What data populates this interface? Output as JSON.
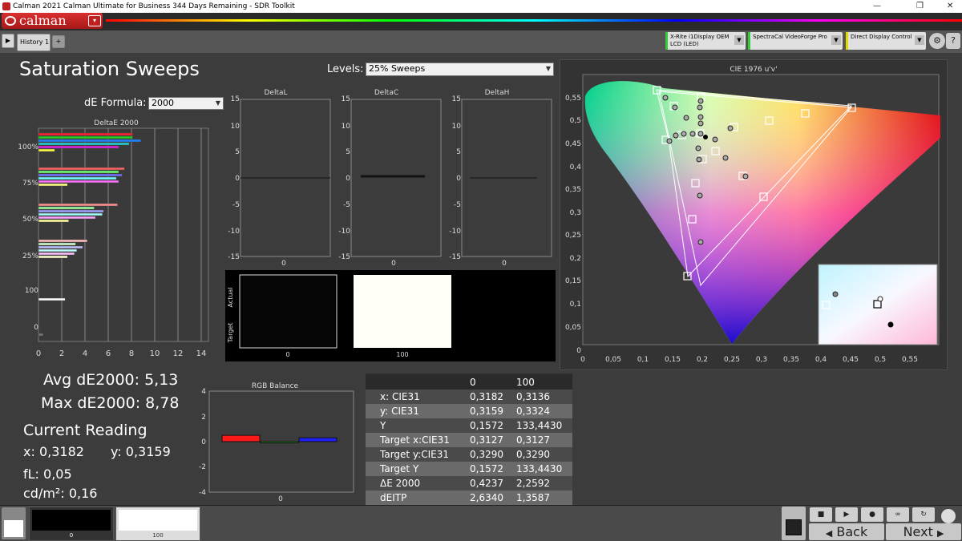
{
  "window": {
    "title": "Calman 2021 Calman Ultimate for Business 344 Days Remaining  - SDR Toolkit",
    "minimize": "—",
    "restore": "❐",
    "close": "✕"
  },
  "brand": {
    "name": "calman",
    "menu_glyph": "▾"
  },
  "tabs": {
    "history_tab": "History 1",
    "add_tab": "+",
    "play": "▶"
  },
  "devices": [
    {
      "line1": "X-Rite i1Display OEM",
      "line2": "LCD (LED)",
      "led": "#33cc33"
    },
    {
      "line1": "SpectraCal VideoForge Pro",
      "line2": "",
      "led": "#33cc33"
    },
    {
      "line1": "Direct Display Control",
      "line2": "",
      "led": "#dddd00"
    }
  ],
  "page": {
    "title": "Saturation Sweeps",
    "levels_label": "Levels:",
    "levels_value": "25% Sweeps",
    "formula_label": "dE Formula:",
    "formula_value": "2000"
  },
  "de_chart": {
    "title": "DeltaE 2000",
    "x_ticks": [
      "0",
      "2",
      "4",
      "6",
      "8",
      "10",
      "12",
      "14"
    ],
    "groups": [
      "100%",
      "75%",
      "50%",
      "25%",
      "100",
      "0"
    ]
  },
  "delta_charts": [
    {
      "title": "DeltaL",
      "x_label": "0"
    },
    {
      "title": "DeltaC",
      "x_label": "0"
    },
    {
      "title": "DeltaH",
      "x_label": "0"
    }
  ],
  "delta_ticks": [
    "15",
    "10",
    "5",
    "0",
    "-5",
    "-10",
    "-15"
  ],
  "swatches": {
    "actual_label": "Actual",
    "target_label": "Target",
    "labels": [
      "0",
      "100"
    ]
  },
  "cie": {
    "title": "CIE 1976 u'v'",
    "x_ticks": [
      "0",
      "0,05",
      "0,1",
      "0,15",
      "0,2",
      "0,25",
      "0,3",
      "0,35",
      "0,4",
      "0,45",
      "0,5",
      "0,55"
    ],
    "y_ticks": [
      "0,55",
      "0,5",
      "0,45",
      "0,4",
      "0,35",
      "0,3",
      "0,25",
      "0,2",
      "0,15",
      "0,1",
      "0,05",
      "0"
    ]
  },
  "rgb": {
    "title": "RGB Balance",
    "y_ticks": [
      "4",
      "2",
      "0",
      "-2",
      "-4"
    ],
    "x_label": "0",
    "red": 0.5,
    "green": -0.1,
    "blue": 0.3
  },
  "stats": {
    "avg": "Avg dE2000: 5,13",
    "max": "Max dE2000: 8,78"
  },
  "reading": {
    "title": "Current Reading",
    "x": "x: 0,3182",
    "y": "y: 0,3159",
    "fl": "fL: 0,05",
    "cdm2": "cd/m²: 0,16"
  },
  "table": {
    "headers": [
      "",
      "0",
      "100"
    ],
    "rows": [
      [
        "x: CIE31",
        "0,3182",
        "0,3136"
      ],
      [
        "y: CIE31",
        "0,3159",
        "0,3324"
      ],
      [
        "Y",
        "0,1572",
        "133,4430"
      ],
      [
        "Target x:CIE31",
        "0,3127",
        "0,3127"
      ],
      [
        "Target y:CIE31",
        "0,3290",
        "0,3290"
      ],
      [
        "Target Y",
        "0,1572",
        "133,4430"
      ],
      [
        "ΔE 2000",
        "0,4237",
        "2,2592"
      ],
      [
        "dEITP",
        "2,6340",
        "1,3587"
      ]
    ]
  },
  "bottom": {
    "patch_labels": [
      "0",
      "100"
    ],
    "back": "Back",
    "next": "Next",
    "back_arrow": "◀",
    "next_arrow": "▶"
  }
}
